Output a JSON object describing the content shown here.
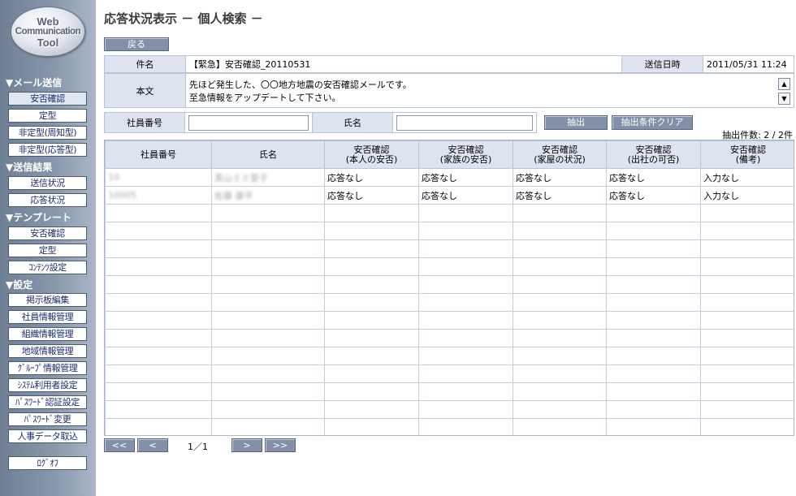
{
  "logo": {
    "line1": "Web",
    "line2": "Communication",
    "line3": "Tool"
  },
  "sidebar": {
    "sections": [
      {
        "title": "▼メール送信",
        "items": [
          "安否確認",
          "定型",
          "非定型(周知型)",
          "非定型(応答型)"
        ]
      },
      {
        "title": "▼送信結果",
        "items": [
          "送信状況",
          "応答状況"
        ]
      },
      {
        "title": "▼テンプレート",
        "items": [
          "安否確認",
          "定型",
          "ｺﾝﾃﾝﾂ設定"
        ]
      },
      {
        "title": "▼設定",
        "items": [
          "掲示板編集",
          "社員情報管理",
          "組織情報管理",
          "地域情報管理",
          "ｸﾞﾙｰﾌﾟ情報管理",
          "ｼｽﾃﾑ利用者設定",
          "ﾊﾟｽﾜｰﾄﾞ認証設定",
          "ﾊﾟｽﾜｰﾄﾞ変更",
          "人事データ取込"
        ]
      }
    ],
    "logout": "ﾛｸﾞｵﾌ"
  },
  "page": {
    "title": "応答状況表示 － 個人検索 －",
    "back_label": "戻る"
  },
  "info": {
    "subject_label": "件名",
    "subject_value": "【緊急】安否確認_20110531",
    "sent_label": "送信日時",
    "sent_value": "2011/05/31 11:24",
    "body_label": "本文",
    "body_line1": "先ほど発生した、〇〇地方地震の安否確認メールです。",
    "body_line2": "至急情報をアップデートして下さい。"
  },
  "search": {
    "emp_label": "社員番号",
    "emp_value": "",
    "name_label": "氏名",
    "name_value": "",
    "extract_label": "抽出",
    "clear_label": "抽出条件クリア",
    "count": "抽出件数: 2 / 2件"
  },
  "table": {
    "headers": [
      {
        "l1": "社員番号",
        "l2": ""
      },
      {
        "l1": "氏名",
        "l2": ""
      },
      {
        "l1": "安否確認",
        "l2": "(本人の安否)"
      },
      {
        "l1": "安否確認",
        "l2": "(家族の安否)"
      },
      {
        "l1": "安否確認",
        "l2": "(家屋の状況)"
      },
      {
        "l1": "安否確認",
        "l2": "(出社の可否)"
      },
      {
        "l1": "安否確認",
        "l2": "(備考)"
      }
    ],
    "rows": [
      [
        "10",
        "黒山ミミ愛子",
        "応答なし",
        "応答なし",
        "応答なし",
        "応答なし",
        "入力なし"
      ],
      [
        "10005",
        "佐藤 康平",
        "応答なし",
        "応答なし",
        "応答なし",
        "応答なし",
        "入力なし"
      ]
    ],
    "empty_rows": 14
  },
  "pager": {
    "first": "<<",
    "prev": "<",
    "next": ">",
    "last": ">>",
    "indicator": "1／1"
  }
}
